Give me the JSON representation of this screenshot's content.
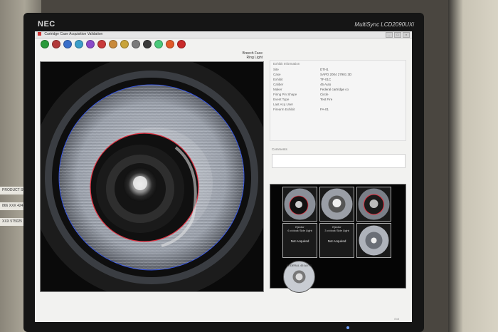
{
  "monitor": {
    "brand": "NEC",
    "model": "MultiSync LCD2090UXi"
  },
  "window": {
    "title": "Cartridge Case Acquisition Validation"
  },
  "toolbar": {
    "buttons": [
      {
        "name": "accept-icon",
        "color": "#2a9a3a"
      },
      {
        "name": "reject-icon",
        "color": "#b23a3a"
      },
      {
        "name": "info-icon",
        "color": "#3a6fc9"
      },
      {
        "name": "refresh-icon",
        "color": "#3a9ec9"
      },
      {
        "name": "settings-icon",
        "color": "#8a4ac9"
      },
      {
        "name": "flag-icon",
        "color": "#c93a3a"
      },
      {
        "name": "undo-icon",
        "color": "#c98a3a"
      },
      {
        "name": "zoom-icon",
        "color": "#c9a43a"
      },
      {
        "name": "tool-icon",
        "color": "#7a7a7a"
      },
      {
        "name": "ring-icon",
        "color": "#3a3a3a"
      },
      {
        "name": "palette-icon",
        "color": "#4ac97a"
      },
      {
        "name": "star-icon",
        "color": "#e05a2a"
      },
      {
        "name": "stop-icon",
        "color": "#c92a2a"
      }
    ]
  },
  "image_label": {
    "line1": "Breech Face",
    "line2": "Ring Light"
  },
  "info": {
    "header": "Exhibit Information",
    "rows": [
      {
        "k": "Site",
        "v": "DTH1"
      },
      {
        "k": "Case",
        "v": "SAPD 2004 27981 3D"
      },
      {
        "k": "Exhibit",
        "v": "TF-01C"
      },
      {
        "k": "Caliber",
        "v": "45 Auto"
      },
      {
        "k": "Maker",
        "v": "Federal cartridge co"
      },
      {
        "k": "Firing Pin Shape",
        "v": "Circle"
      },
      {
        "k": "Event Type",
        "v": "Test Fire"
      },
      {
        "k": "Last Acq User",
        "v": ""
      },
      {
        "k": "Firearm Exhibit",
        "v": "FA-01"
      }
    ]
  },
  "comments": {
    "label": "Comments"
  },
  "thumbs": {
    "ejector1": "Ejector",
    "ejector1_sub": "6 o'clock Side Light",
    "ejector2": "Ejector",
    "ejector2_sub": "3 o'clock Side Light",
    "not_acquired": "Not Acquired",
    "headstamp": "FEDERAL 45 AUTO"
  },
  "colors": {
    "accent_ring": "#e03040",
    "firing_pin_circle": "#3050e0"
  }
}
